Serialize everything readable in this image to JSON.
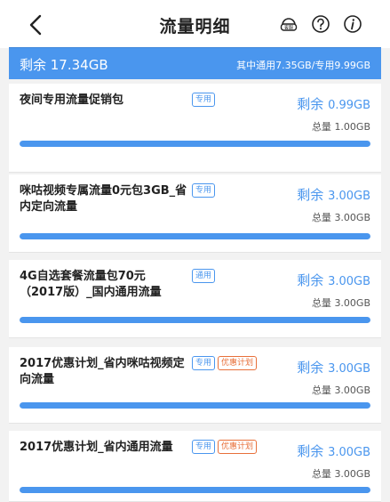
{
  "header": {
    "title": "流量明细",
    "service_icon_label": "客服"
  },
  "summary": {
    "remaining": "剩余 17.34GB",
    "breakdown": "其中通用7.35GB/专用9.99GB"
  },
  "packages": [
    {
      "name": "夜间专用流量促销包",
      "tags": [
        "专用"
      ],
      "promo_tag": "",
      "remain_label": "剩余",
      "remain_value": "0.99GB",
      "total_label": "总量",
      "total_value": "1.00GB",
      "usage_fill": 1.0
    },
    {
      "name": "咪咕视频专属流量0元包3GB_省内定向流量",
      "tags": [
        "专用"
      ],
      "promo_tag": "",
      "remain_label": "剩余",
      "remain_value": "3.00GB",
      "total_label": "总量",
      "total_value": "3.00GB",
      "usage_fill": 1.0
    },
    {
      "name": "4G自选套餐流量包70元（2017版）_国内通用流量",
      "tags": [
        "通用"
      ],
      "promo_tag": "",
      "remain_label": "剩余",
      "remain_value": "3.00GB",
      "total_label": "总量",
      "total_value": "3.00GB",
      "usage_fill": 1.0
    },
    {
      "name": "2017优惠计划_省内咪咕视频定向流量",
      "tags": [
        "专用"
      ],
      "promo_tag": "优惠计划",
      "remain_label": "剩余",
      "remain_value": "3.00GB",
      "total_label": "总量",
      "total_value": "3.00GB",
      "usage_fill": 1.0
    },
    {
      "name": "2017优惠计划_省内通用流量",
      "tags": [
        "专用"
      ],
      "promo_tag": "优惠计划",
      "remain_label": "剩余",
      "remain_value": "3.00GB",
      "total_label": "总量",
      "total_value": "3.00GB",
      "usage_fill": 1.0
    }
  ],
  "colors": {
    "accent": "#4a96ee",
    "promo": "#e8703a"
  },
  "icons": [
    "back-icon",
    "customer-service-icon",
    "help-icon",
    "info-icon"
  ]
}
